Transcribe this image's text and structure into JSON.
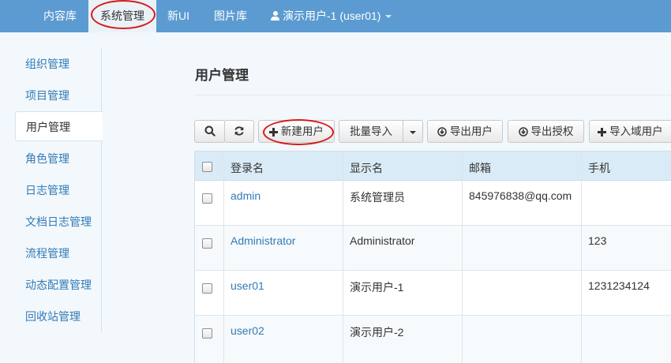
{
  "topnav": {
    "items": [
      "内容库",
      "系统管理",
      "新UI",
      "图片库"
    ],
    "user_label": "演示用户-1 (user01)"
  },
  "sidebar": {
    "items": [
      "组织管理",
      "项目管理",
      "用户管理",
      "角色管理",
      "日志管理",
      "文档日志管理",
      "流程管理",
      "动态配置管理",
      "回收站管理"
    ],
    "active": "用户管理"
  },
  "main": {
    "title": "用户管理",
    "toolbar": {
      "new_user": "新建用户",
      "batch_import": "批量导入",
      "export_users": "导出用户",
      "export_auth": "导出授权",
      "import_domain": "导入域用户"
    }
  },
  "table": {
    "columns": [
      "登录名",
      "显示名",
      "邮箱",
      "手机"
    ],
    "rows": [
      {
        "login": "admin",
        "display": "系统管理员",
        "email": "845976838@qq.com",
        "phone": ""
      },
      {
        "login": "Administrator",
        "display": "Administrator",
        "email": "",
        "phone": "123"
      },
      {
        "login": "user01",
        "display": "演示用户-1",
        "email": "",
        "phone": "1231234124"
      },
      {
        "login": "user02",
        "display": "演示用户-2",
        "email": "",
        "phone": ""
      }
    ]
  },
  "colors": {
    "nav_bg": "#5b9bd1",
    "link": "#337ab7",
    "table_header": "#d9ebf6",
    "annotation": "#d81a1a"
  }
}
